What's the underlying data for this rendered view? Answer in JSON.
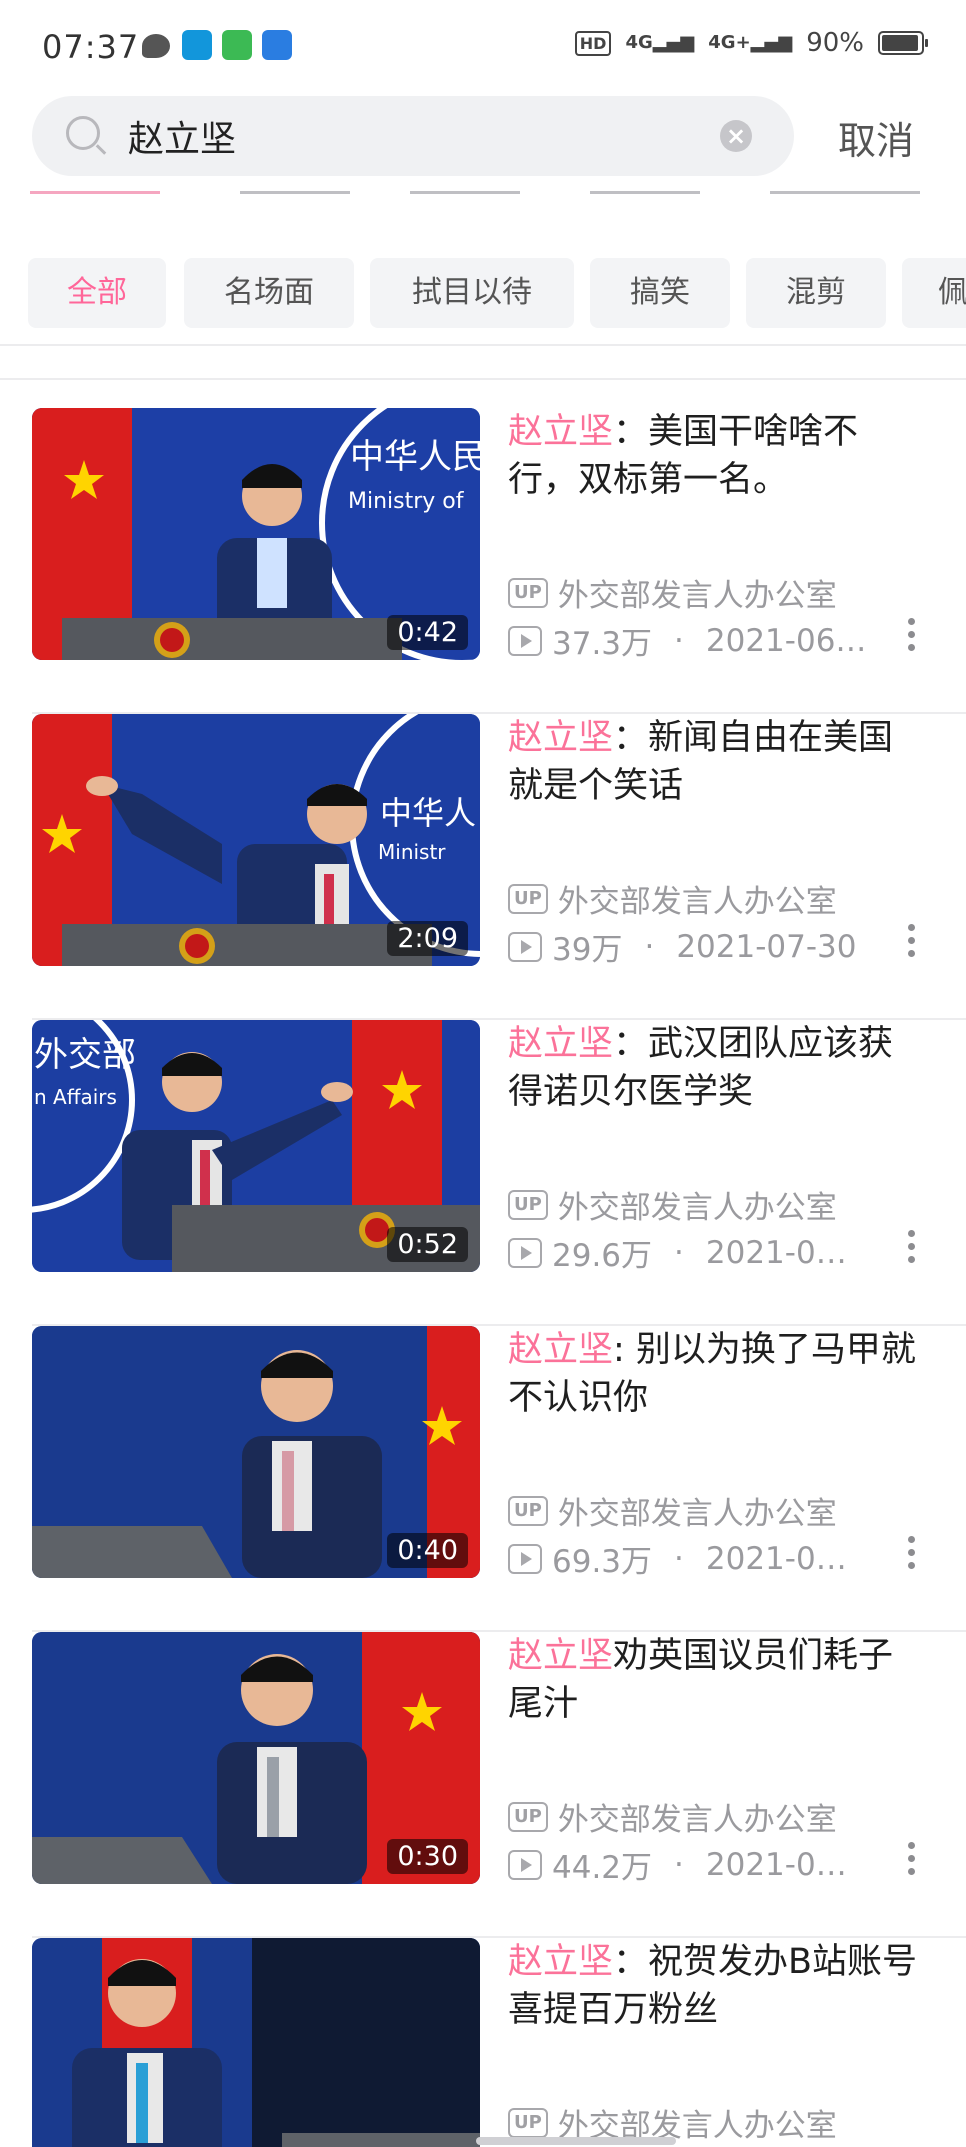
{
  "status_bar": {
    "time": "07:37",
    "network_1": "4G",
    "network_2": "4G+",
    "battery": "90%",
    "icons": [
      "message-icon",
      "app-icon-blue",
      "app-icon-green",
      "app-icon-bot"
    ]
  },
  "search": {
    "query": "赵立坚",
    "cancel_label": "取消"
  },
  "filters": [
    {
      "label": "全部",
      "active": true
    },
    {
      "label": "名场面",
      "active": false
    },
    {
      "label": "拭目以待",
      "active": false
    },
    {
      "label": "搞笑",
      "active": false
    },
    {
      "label": "混剪",
      "active": false
    },
    {
      "label": "佩",
      "active": false
    }
  ],
  "videos": [
    {
      "highlight": "赵立坚",
      "rest": "：美国干啥啥不行，双标第一名。",
      "duration": "0:42",
      "uploader": "外交部发言人办公室",
      "views": "37.3万",
      "date": "2021-06…"
    },
    {
      "highlight": "赵立坚",
      "rest": "：新闻自由在美国就是个笑话",
      "duration": "2:09",
      "uploader": "外交部发言人办公室",
      "views": "39万",
      "date": "2021-07-30"
    },
    {
      "highlight": "赵立坚",
      "rest": "：武汉团队应该获得诺贝尔医学奖",
      "duration": "0:52",
      "uploader": "外交部发言人办公室",
      "views": "29.6万",
      "date": "2021-0…"
    },
    {
      "highlight": "赵立坚",
      "rest": ": 别以为换了马甲就不认识你",
      "duration": "0:40",
      "uploader": "外交部发言人办公室",
      "views": "69.3万",
      "date": "2021-0…"
    },
    {
      "highlight": "赵立坚",
      "rest": "劝英国议员们耗子尾汁",
      "duration": "0:30",
      "uploader": "外交部发言人办公室",
      "views": "44.2万",
      "date": "2021-0…"
    },
    {
      "highlight": "赵立坚",
      "rest": "：祝贺发办B站账号喜提百万粉丝",
      "duration": "",
      "uploader": "外交部发言人办公室",
      "views": "",
      "date": ""
    }
  ],
  "thumbnail_text": {
    "sign_1": "中华人民",
    "sign_1_en": "Ministry of",
    "sign_2": "中华人",
    "sign_2_en": "Ministr",
    "sign_3": "外交部",
    "sign_3_en": "n Affairs"
  },
  "labels": {
    "up_badge": "UP",
    "dot": "·"
  },
  "colors": {
    "accent": "#fb7299",
    "chip_bg": "#f3f4f6",
    "text_muted": "#9a9a9e"
  }
}
